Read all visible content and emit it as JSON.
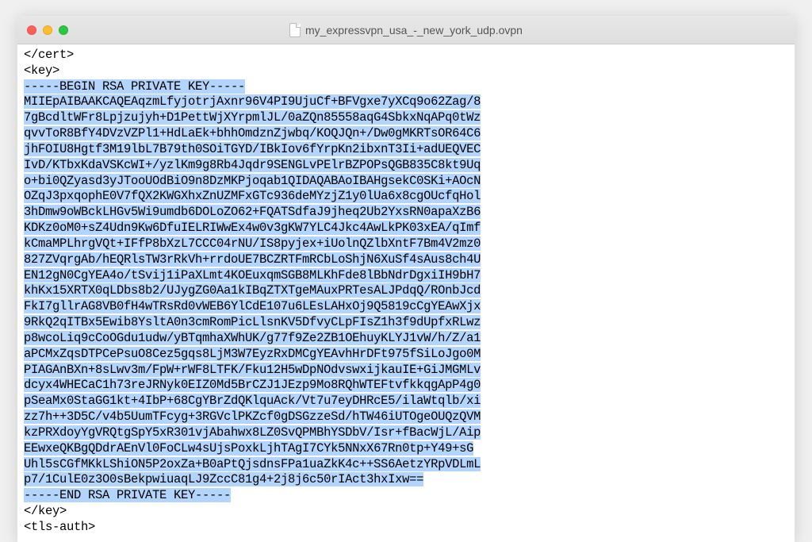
{
  "window": {
    "filename": "my_expressvpn_usa_-_new_york_udp.ovpn"
  },
  "colors": {
    "selection": "#b3d4fc",
    "close": "#ff5f57",
    "minimize": "#ffbd2e",
    "maximize": "#28c840"
  },
  "file_content": {
    "before_selection": [
      "</cert>",
      "<key>"
    ],
    "selected_lines": [
      "-----BEGIN RSA PRIVATE KEY-----",
      "MIIEpAIBAAKCAQEAqzmLfyjotrjAxnr96V4PI9UjuCf+BFVgxe7yXCq9o62Zag/8",
      "7gBcdltWFr8Lpjzujyh+D1PettWjXYrpmlJL/0aZQn85558aqG4SbkxNqAPq0tWz",
      "qvvToR8BfY4DVzVZPl1+HdLaEk+bhhOmdznZjwbq/KOQJQn+/Dw0gMKRTsOR64C6",
      "jhFOIU8Hgtf3M19lbL7B79th0SOiTGYD/IBkIov6fYrpKn2ibxnT3Ii+adUEQVEC",
      "IvD/KTbxKdaVSKcWI+/yzlKm9g8Rb4Jqdr9SENGLvPElrBZPOPsQGB835C8kt9Uq",
      "o+bi0QZyasd3yJTooUOdBiO9n8DzMKPjoqab1QIDAQABAoIBAHgsekC0SKi+AOcN",
      "OZqJ3pxqophE0V7fQX2KWGXhxZnUZMFxGTc936deMYzjZ1y0lUa6x8cgOUcfqHol",
      "3hDmw9oWBckLHGv5Wi9umdb6DOLoZO62+FQATSdfaJ9jheq2Ub2YxsRN0apaXzB6",
      "KDKz0oM0+sZ4Udn9Kw6DfuIELRIWwEx4w0v3gKW7YLC4Jkc4AwLkPK03xEA/qImf",
      "kCmaMPLhrgVQt+IFfP8bXzL7CCC04rNU/IS8pyjex+iUolnQZlbXntF7Bm4V2mz0",
      "827ZVqrgAb/hEQRlsTW3rRkVh+rrdoUE7BCZRTFmRCbLoShjN6XuSf4sAus8ch4U",
      "EN12gN0CgYEA4o/tSvij1iPaXLmt4KOEuxqmSGB8MLKhFde8lBbNdrDgxiIH9bH7",
      "khKx15XRTX0qLDbs8b2/UJygZG0Aa1kIBqZTXTgeMAuxPRTesALJPdqQ/ROnbJcd",
      "FkI7gllrAG8VB0fH4wTRsRd0vWEB6YlCdE107u6LEsLAHxOj9Q5819cCgYEAwXjx",
      "9RkQ2qITBx5Ewib8YsltA0n3cmRomPicLlsnKV5DfvyCLpFIsZ1h3f9dUpfxRLwz",
      "p8wcoLiq9cCoOGdu1udw/yBTqmhaXWhUK/g77f9Ze2ZB1OEhuyKLYJ1vW/h/Z/a1",
      "aPCMxZqsDTPCePsuO8Cez5gqs8LjM3W7EyzRxDMCgYEAvhHrDFt975fSiLoJgo0M",
      "PIAGAnBXn+8sLwv3m/FpW+rWF8LTFK/Fku12H5wDpNOdvswxijkauIE+GiJMGMLv",
      "dcyx4WHECaC1h73reJRNyk0EIZ0Md5BrCZJ1JEzp9Mo8RQhWTEFtvfkkqgApP4g0",
      "pSeaMx0StaGG1kt+4IbP+68CgYBrZdQKlquAck/Vt7u7eyDHRcE5/ilaWtqlb/xi",
      "zz7h++3D5C/v4b5UumTFcyg+3RGVclPKZcf0gDSGzzeSd/hTW46iUTOgeOUQzQVM",
      "kzPRXdoyYgVRQtgSpY5xR301vjAbahwx8LZ0SvQPMBhYSDbV/Isr+fBacWjL/Aip",
      "EEwxeQKBgQDdrAEnVl0FoCLw4sUjsPoxkLjhTAgI7CYk5NNxX67Rn0tp+Y49+sG",
      "Uhl5sCGfMKkLShiON5P2oxZa+B0aPtQjsdnsFPa1uaZkK4c++SS6AetzYRpVDLmL",
      "p7/1CulE0z3O0sBekpwiuaqLJ9ZccC81g4+2j8j6c50rIAct3hxIxw==",
      "-----END RSA PRIVATE KEY-----"
    ],
    "after_selection": [
      "</key>",
      "<tls-auth>"
    ]
  }
}
